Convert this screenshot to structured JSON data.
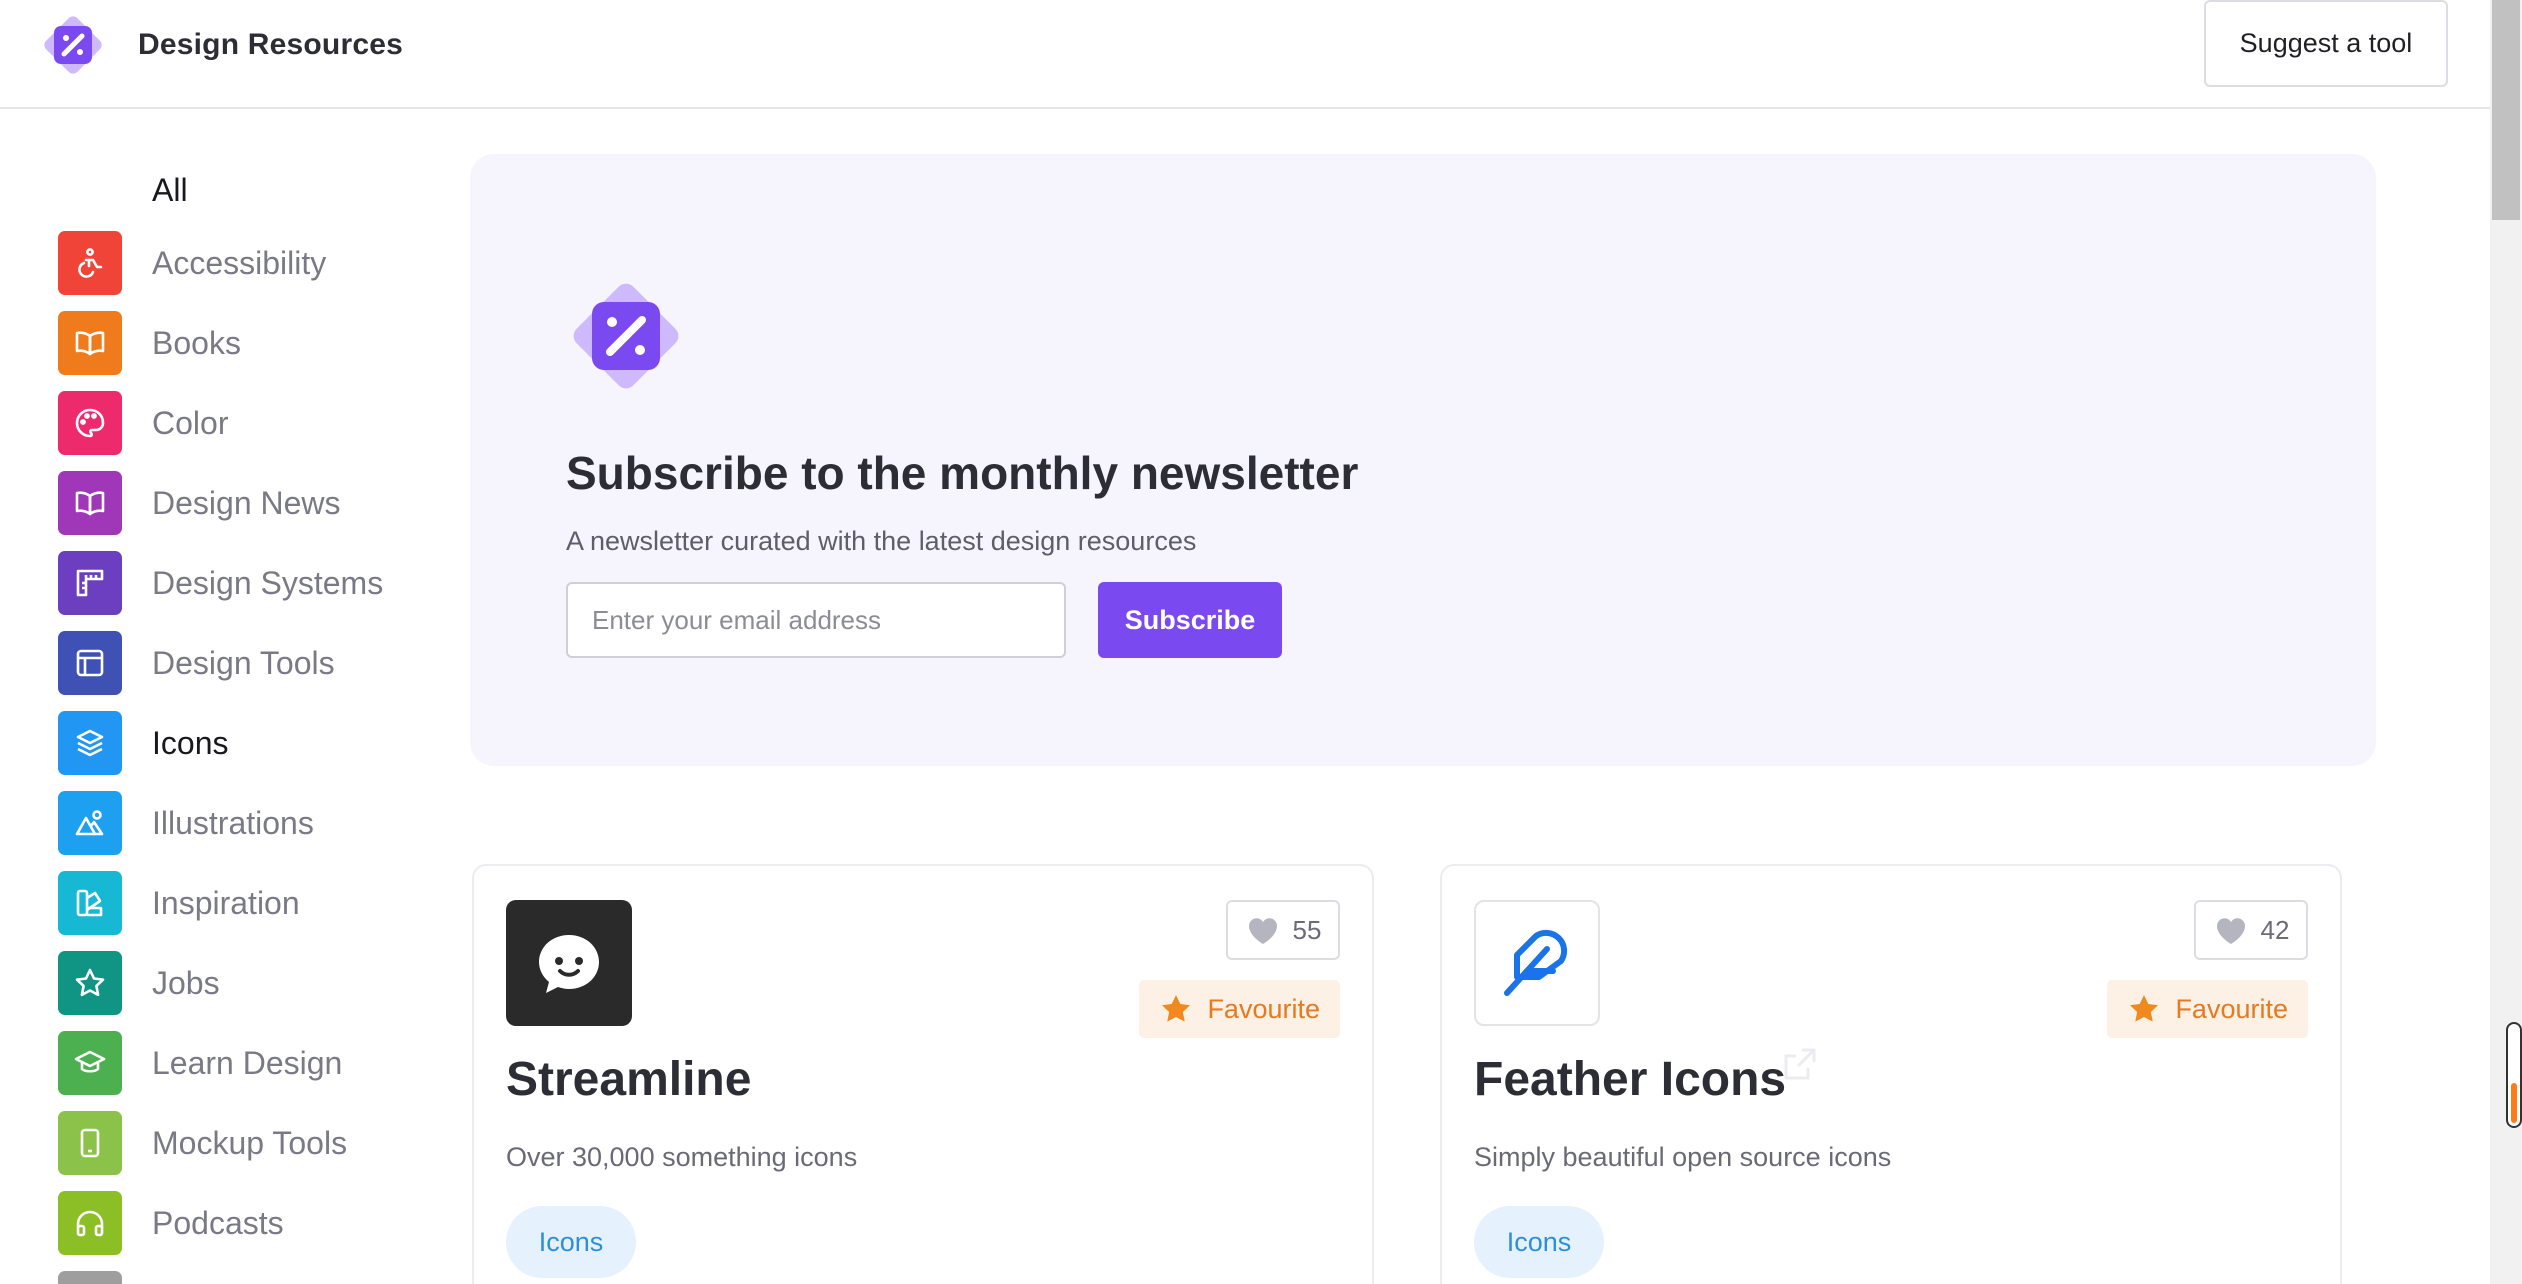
{
  "header": {
    "title": "Design Resources",
    "suggest_label": "Suggest a tool"
  },
  "sidebar": {
    "all_label": "All",
    "items": [
      {
        "label": "Accessibility",
        "icon": "accessibility-icon",
        "color": "#f04438"
      },
      {
        "label": "Books",
        "icon": "book-icon",
        "color": "#ef7b1c"
      },
      {
        "label": "Color",
        "icon": "palette-icon",
        "color": "#ec2a6c"
      },
      {
        "label": "Design News",
        "icon": "book-icon",
        "color": "#a037b8"
      },
      {
        "label": "Design Systems",
        "icon": "ruler-icon",
        "color": "#6c3fc0"
      },
      {
        "label": "Design Tools",
        "icon": "layout-icon",
        "color": "#3f51b5"
      },
      {
        "label": "Icons",
        "icon": "layers-icon",
        "color": "#2196f3"
      },
      {
        "label": "Illustrations",
        "icon": "image-icon",
        "color": "#1ea0f0"
      },
      {
        "label": "Inspiration",
        "icon": "swatches-icon",
        "color": "#17b8d4"
      },
      {
        "label": "Jobs",
        "icon": "star-icon",
        "color": "#109483"
      },
      {
        "label": "Learn Design",
        "icon": "graduation-cap-icon",
        "color": "#4caf50"
      },
      {
        "label": "Mockup Tools",
        "icon": "phone-icon",
        "color": "#8bc34a"
      },
      {
        "label": "Podcasts",
        "icon": "headphones-icon",
        "color": "#8cbf26"
      }
    ],
    "active": "Icons"
  },
  "newsletter": {
    "title": "Subscribe to the monthly newsletter",
    "subtitle": "A newsletter curated with the latest design resources",
    "email_placeholder": "Enter your email address",
    "button_label": "Subscribe"
  },
  "cards": [
    {
      "title": "Streamline",
      "description": "Over 30,000 something icons",
      "likes": "55",
      "badge": "Favourite",
      "tag": "Icons",
      "logo": "chat-bubble-icon"
    },
    {
      "title": "Feather Icons",
      "description": "Simply beautiful open source icons",
      "likes": "42",
      "badge": "Favourite",
      "tag": "Icons",
      "logo": "feather-icon"
    }
  ],
  "colors": {
    "accent": "#7a4af0",
    "favourite": "#e57a1f",
    "tag_text": "#2e8fd8"
  }
}
